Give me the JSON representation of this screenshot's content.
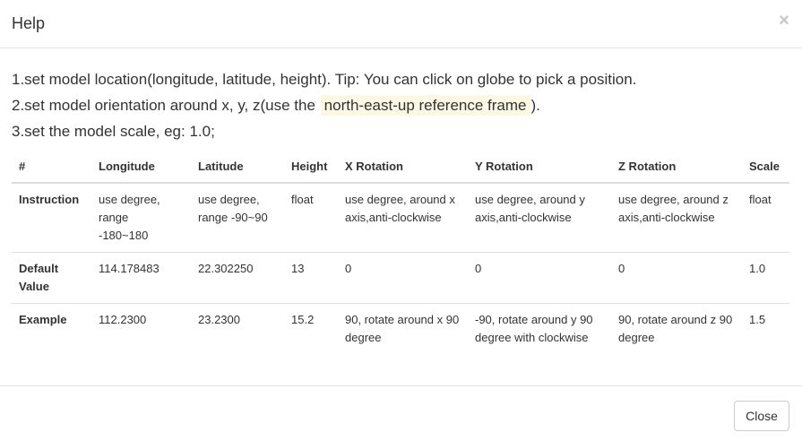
{
  "dialog": {
    "title": "Help",
    "close_symbol": "×"
  },
  "steps": {
    "step1": "1.set model location(longitude, latitude, height). Tip: You can click on globe to pick a position.",
    "step2_before": "2.set model orientation around x, y, z(use the",
    "step2_highlight": "north-east-up reference frame",
    "step2_after": ").",
    "step3": "3.set the model scale, eg: 1.0;"
  },
  "table": {
    "headers": [
      "#",
      "Longitude",
      "Latitude",
      "Height",
      "X Rotation",
      "Y Rotation",
      "Z Rotation",
      "Scale"
    ],
    "rows": [
      {
        "label": "Instruction",
        "cells": [
          "use degree, range -180~180",
          "use degree, range -90~90",
          "float",
          "use degree, around x axis,anti-clockwise",
          "use degree, around y axis,anti-clockwise",
          "use degree, around z axis,anti-clockwise",
          "float"
        ]
      },
      {
        "label": "Default Value",
        "cells": [
          "114.178483",
          "22.302250",
          "13",
          "0",
          "0",
          "0",
          "1.0"
        ]
      },
      {
        "label": "Example",
        "cells": [
          "112.2300",
          "23.2300",
          "15.2",
          "90, rotate around x 90 degree",
          "-90, rotate around y 90 degree with clockwise",
          "90, rotate around z 90 degree",
          "1.5"
        ]
      }
    ]
  },
  "footer": {
    "close_label": "Close"
  }
}
